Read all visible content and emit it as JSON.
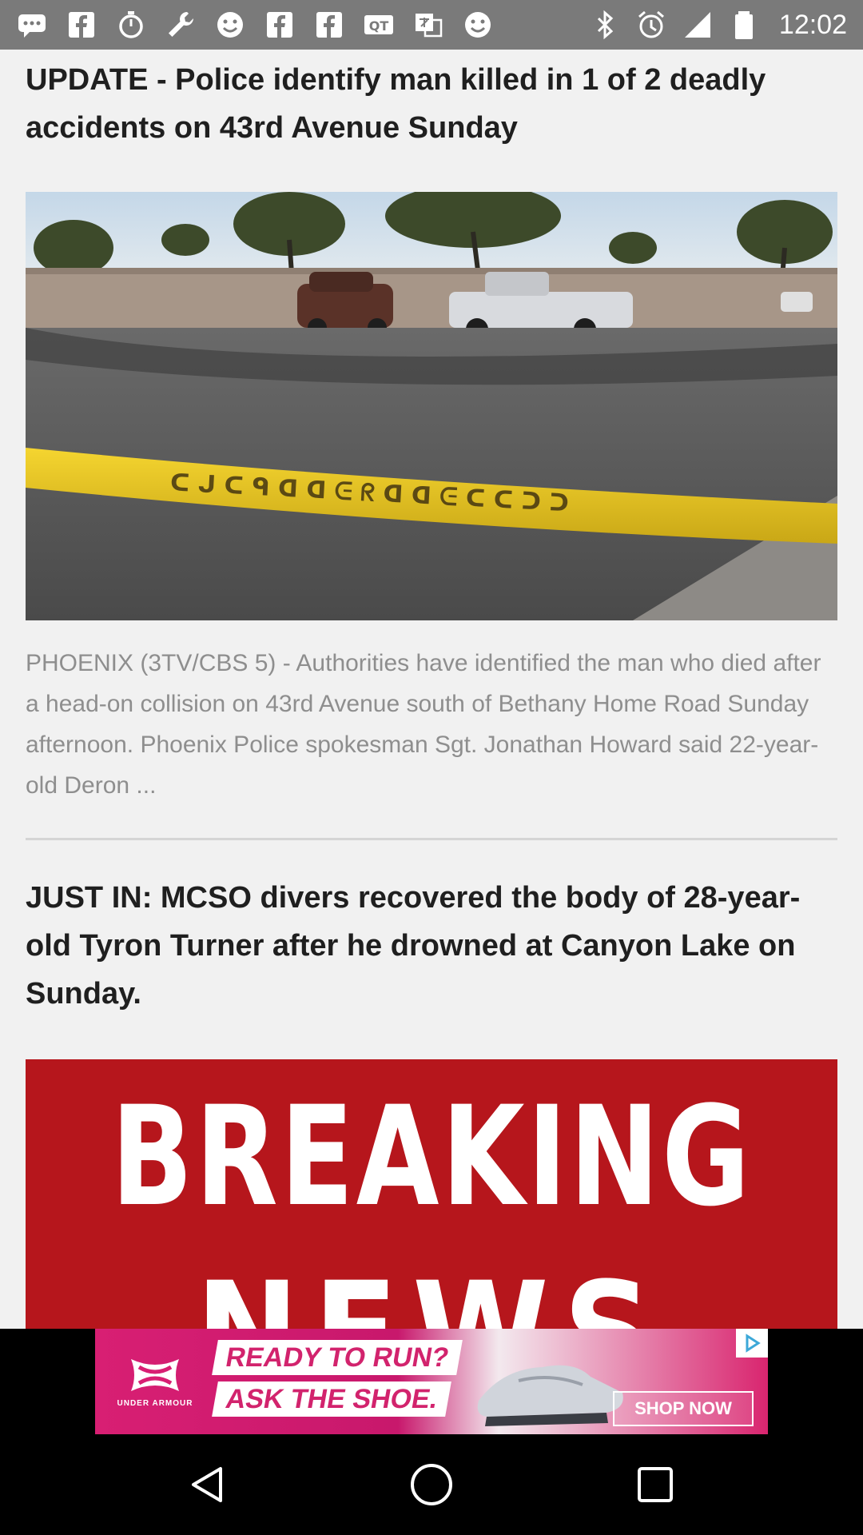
{
  "status_bar": {
    "time": "12:02",
    "left_icons": [
      "chat-bubble-icon",
      "facebook-icon",
      "stopwatch-icon",
      "wrench-icon",
      "smiley-icon",
      "facebook-icon",
      "facebook-icon",
      "qt-icon",
      "translate-icon",
      "smiley-icon"
    ],
    "right_icons": [
      "bluetooth-icon",
      "alarm-icon",
      "signal-icon",
      "battery-icon"
    ]
  },
  "articles": [
    {
      "title": "UPDATE - Police identify man killed in 1 of 2 deadly accidents on 43rd Avenue Sunday",
      "image": "crime-scene-tape-road-photo",
      "summary": "PHOENIX (3TV/CBS 5) - Authorities have identified the man who died after a head-on collision on 43rd Avenue south of Bethany Home Road Sunday afternoon.  Phoenix Police spokesman Sgt. Jonathan Howard said 22-year-old Deron ..."
    },
    {
      "title": "JUST IN: MCSO divers recovered the body of 28-year-old Tyron Turner after he drowned at Canyon Lake on Sunday.",
      "image_text_line1": "BREAKING",
      "image_text_line2": "NEWS"
    }
  ],
  "ad": {
    "brand": "UNDER ARMOUR",
    "line1": "READY TO RUN?",
    "line2": "ASK THE SHOE.",
    "cta": "SHOP NOW",
    "colors": {
      "background": "#d81f73",
      "text": "#ffffff"
    }
  },
  "nav_bar": {
    "buttons": [
      "back-icon",
      "home-icon",
      "recents-icon"
    ]
  }
}
